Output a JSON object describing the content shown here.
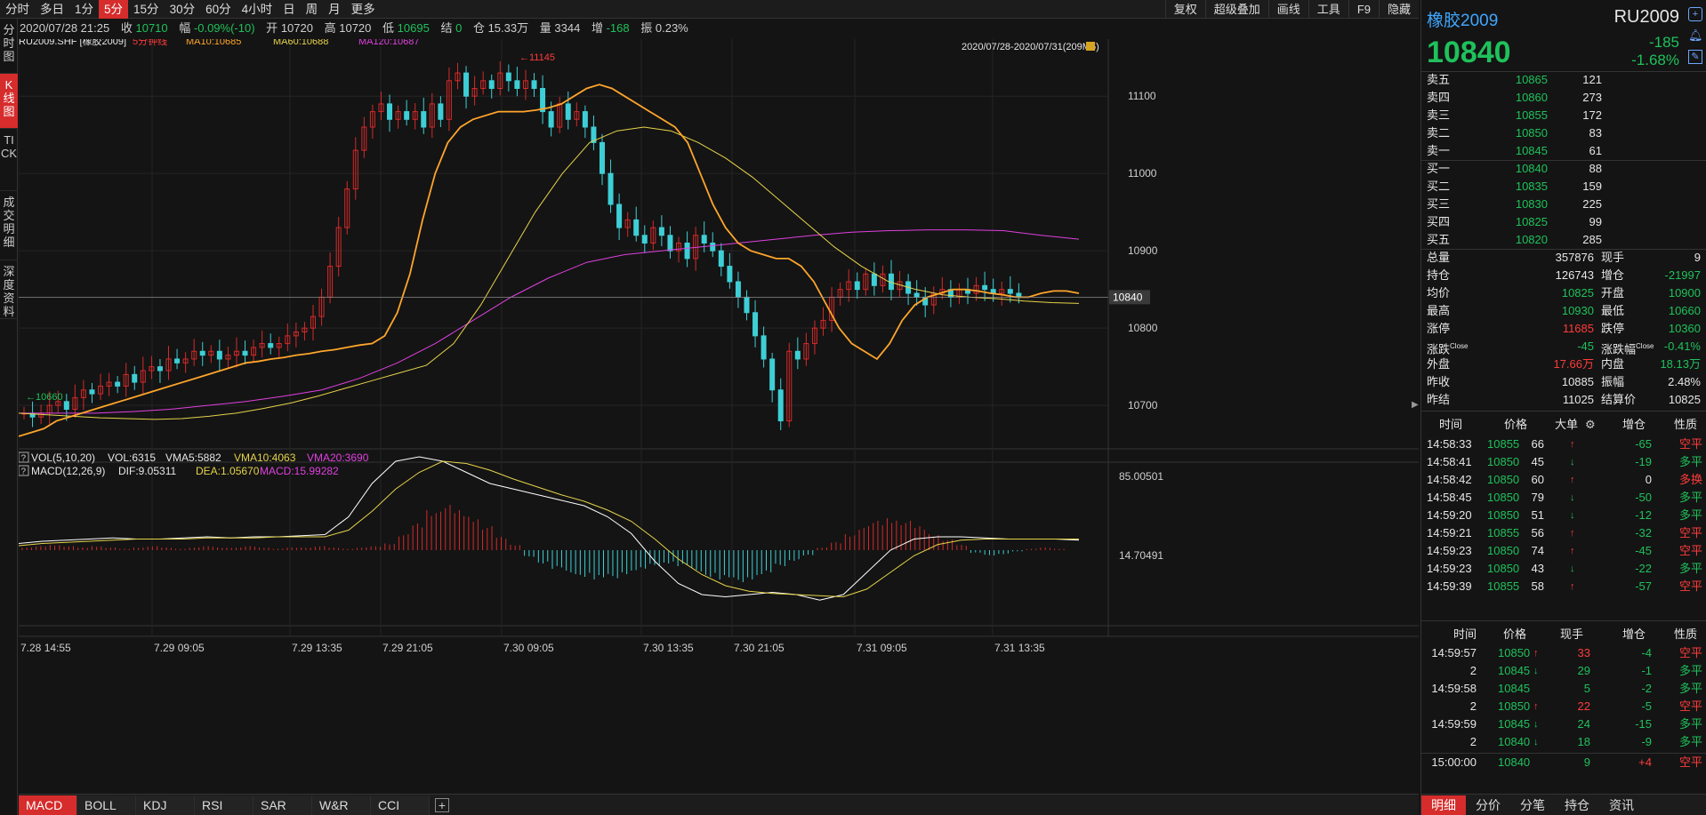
{
  "colors": {
    "up": "#ff3b3b",
    "down": "#1fc15b",
    "ma10": "#ffa52b",
    "ma60": "#e6d34a",
    "ma120": "#e040e0",
    "candle_up": "#d42a2a",
    "candle_down": "#3ecfd6",
    "active_tab": "#d62c2c"
  },
  "period_tabs": [
    "分时",
    "多日",
    "1分",
    "5分",
    "15分",
    "30分",
    "60分",
    "4小时",
    "日",
    "周",
    "月",
    "更多"
  ],
  "active_period": "5分",
  "right_buttons": [
    "复权",
    "超级叠加",
    "画线",
    "工具",
    "F9",
    "隐藏"
  ],
  "side_tabs": [
    "分时图",
    "K线图",
    "TICK",
    "成交明细",
    "深度资料"
  ],
  "active_side_tab": "K线图",
  "quote_bar": {
    "datetime": "2020/07/28 21:25",
    "close_label": "收",
    "close": "10710",
    "change_label": "幅",
    "change": "-0.09%(-10)",
    "open_label": "开",
    "open": "10720",
    "high_label": "高",
    "high": "10720",
    "low_label": "低",
    "low": "10695",
    "settle_label": "结",
    "settle": "0",
    "oi_label": "仓",
    "oi": "15.33万",
    "vol_label": "量",
    "vol": "3344",
    "inc_label": "增",
    "inc": "-168",
    "amp_label": "振",
    "amp": "0.23%"
  },
  "chart_header": {
    "symbol": "RU2009.SHF [橡胶2009]",
    "period": "5分钟线",
    "ma10": "MA10:10685",
    "ma60": "MA60:10688",
    "ma120": "MA120:10687",
    "range": "2020/07/28-2020/07/31(209M5)"
  },
  "vol_header": {
    "q": "?",
    "name": "VOL(5,10,20)",
    "vol": "VOL:6315",
    "vma5": "VMA5:5882",
    "vma10": "VMA10:4063",
    "vma20": "VMA20:3690"
  },
  "macd_header": {
    "q": "?",
    "name": "MACD(12,26,9)",
    "dif": "DIF:9.05311",
    "dea": "DEA:1.05670",
    "macd": "MACD:15.99282"
  },
  "indicator_tabs": [
    "MACD",
    "BOLL",
    "KDJ",
    "RSI",
    "SAR",
    "W&R",
    "CCI"
  ],
  "active_indicator": "MACD",
  "add_indicator": "+",
  "chart_data": {
    "type": "candlestick",
    "price_axis_ticks": [
      11100,
      11000,
      10900,
      10800,
      10700
    ],
    "ylim": [
      10640,
      11150
    ],
    "current_price": 10840,
    "current_price_label": "10840",
    "max_marker": "11145",
    "min_marker": "10660",
    "time_ticks": [
      "7.28 14:55",
      "7.29 09:05",
      "7.29 13:35",
      "7.29 21:05",
      "7.30 09:05",
      "7.30 13:35",
      "7.30 21:05",
      "7.31 09:05",
      "7.31 13:35"
    ],
    "macd_axis_ticks": [
      "85.00501",
      "14.70491"
    ],
    "close_path": [
      10690,
      10685,
      10690,
      10700,
      10705,
      10695,
      10710,
      10720,
      10715,
      10725,
      10730,
      10725,
      10740,
      10730,
      10745,
      10750,
      10745,
      10760,
      10755,
      10760,
      10770,
      10765,
      10770,
      10760,
      10765,
      10770,
      10765,
      10775,
      10780,
      10775,
      10780,
      10790,
      10795,
      10800,
      10815,
      10840,
      10880,
      10930,
      10980,
      11030,
      11060,
      11080,
      11090,
      11070,
      11080,
      11070,
      11080,
      11060,
      11090,
      11070,
      11120,
      11130,
      11100,
      11110,
      11120,
      11110,
      11130,
      11120,
      11110,
      11120,
      11110,
      11080,
      11060,
      11090,
      11070,
      11080,
      11060,
      11040,
      11000,
      10960,
      10930,
      10940,
      10920,
      10910,
      10930,
      10920,
      10900,
      10910,
      10890,
      10920,
      10910,
      10900,
      10880,
      10860,
      10840,
      10820,
      10790,
      10760,
      10720,
      10680,
      10770,
      10760,
      10780,
      10800,
      10810,
      10840,
      10850,
      10860,
      10850,
      10870,
      10855,
      10870,
      10850,
      10860,
      10845,
      10840,
      10830,
      10845,
      10850,
      10840,
      10850,
      10845,
      10855,
      10850,
      10845,
      10850,
      10845,
      10840
    ],
    "ma10_path": [
      10660,
      10665,
      10670,
      10680,
      10685,
      10690,
      10695,
      10700,
      10705,
      10710,
      10715,
      10720,
      10725,
      10730,
      10735,
      10740,
      10745,
      10750,
      10755,
      10757,
      10760,
      10762,
      10765,
      10767,
      10770,
      10772,
      10775,
      10778,
      10780,
      10790,
      10820,
      10870,
      10940,
      11000,
      11040,
      11060,
      11070,
      11075,
      11080,
      11080,
      11080,
      11082,
      11085,
      11090,
      11100,
      11110,
      11115,
      11110,
      11100,
      11090,
      11080,
      11070,
      11060,
      11040,
      11000,
      10960,
      10930,
      10910,
      10900,
      10895,
      10890,
      10890,
      10880,
      10860,
      10830,
      10800,
      10780,
      10770,
      10760,
      10780,
      10810,
      10830,
      10840,
      10845,
      10850,
      10850,
      10848,
      10845,
      10843,
      10840,
      10840,
      10845,
      10848,
      10848,
      10845
    ],
    "ma60_path": [
      10690,
      10688,
      10686,
      10684,
      10683,
      10682,
      10683,
      10686,
      10690,
      10696,
      10703,
      10712,
      10722,
      10732,
      10742,
      10752,
      10780,
      10830,
      10890,
      10950,
      11000,
      11040,
      11055,
      11060,
      11055,
      11040,
      11020,
      10995,
      10965,
      10935,
      10905,
      10880,
      10860,
      10850,
      10843,
      10840,
      10838,
      10835,
      10833,
      10832
    ],
    "ma120_path": [
      10690,
      10690,
      10690,
      10692,
      10695,
      10700,
      10705,
      10712,
      10720,
      10735,
      10755,
      10780,
      10810,
      10840,
      10865,
      10885,
      10895,
      10900,
      10905,
      10910,
      10915,
      10920,
      10924,
      10926,
      10927,
      10927,
      10926,
      10920,
      10915
    ],
    "volume_bars": [],
    "macd_hist": [
      2,
      3,
      4,
      3,
      2,
      3,
      2,
      1,
      2,
      3,
      2,
      1,
      2,
      3,
      2,
      2,
      3,
      2,
      1,
      2,
      2,
      3,
      2,
      1,
      2,
      3,
      5,
      12,
      20,
      30,
      34,
      30,
      25,
      18,
      10,
      4,
      -5,
      -10,
      -14,
      -18,
      -20,
      -22,
      -21,
      -18,
      -15,
      -12,
      -10,
      -12,
      -16,
      -20,
      -22,
      -24,
      -22,
      -18,
      -12,
      -8,
      -4,
      2,
      6,
      12,
      18,
      22,
      24,
      22,
      18,
      12,
      8,
      4,
      -2,
      -4,
      -3,
      -1,
      1,
      2,
      1,
      0
    ],
    "dif_path": [
      6,
      8,
      9,
      10,
      11,
      10,
      10,
      11,
      12,
      11,
      12,
      12,
      13,
      14,
      30,
      60,
      80,
      84,
      80,
      70,
      60,
      55,
      50,
      45,
      40,
      30,
      15,
      -10,
      -30,
      -40,
      -42,
      -40,
      -38,
      -40,
      -45,
      -40,
      -20,
      0,
      10,
      12,
      12,
      11,
      10,
      10,
      10,
      9
    ],
    "dea_path": [
      4,
      6,
      7,
      8,
      9,
      10,
      10,
      10,
      11,
      11,
      11,
      12,
      12,
      12,
      18,
      35,
      55,
      70,
      80,
      78,
      72,
      64,
      57,
      50,
      44,
      36,
      26,
      10,
      -8,
      -22,
      -32,
      -37,
      -39,
      -40,
      -41,
      -42,
      -35,
      -20,
      -5,
      5,
      9,
      10,
      10,
      10,
      10,
      10
    ]
  },
  "right_panel": {
    "name": "橡胶2009",
    "code": "RU2009",
    "price": "10840",
    "change": "-185",
    "change_pct": "-1.68%",
    "asks": [
      {
        "label": "卖五",
        "price": "10865",
        "vol": "121"
      },
      {
        "label": "卖四",
        "price": "10860",
        "vol": "273"
      },
      {
        "label": "卖三",
        "price": "10855",
        "vol": "172"
      },
      {
        "label": "卖二",
        "price": "10850",
        "vol": "83"
      },
      {
        "label": "卖一",
        "price": "10845",
        "vol": "61"
      }
    ],
    "bids": [
      {
        "label": "买一",
        "price": "10840",
        "vol": "88"
      },
      {
        "label": "买二",
        "price": "10835",
        "vol": "159"
      },
      {
        "label": "买三",
        "price": "10830",
        "vol": "225"
      },
      {
        "label": "买四",
        "price": "10825",
        "vol": "99"
      },
      {
        "label": "买五",
        "price": "10820",
        "vol": "285"
      }
    ],
    "stats": [
      [
        {
          "k": "总量",
          "v": "357876",
          "c": "white"
        },
        {
          "k": "现手",
          "v": "9",
          "c": "white"
        }
      ],
      [
        {
          "k": "持仓",
          "v": "126743",
          "c": "white"
        },
        {
          "k": "增仓",
          "v": "-21997",
          "c": "green"
        }
      ],
      [
        {
          "k": "均价",
          "v": "10825",
          "c": "green"
        },
        {
          "k": "开盘",
          "v": "10900",
          "c": "green"
        }
      ],
      [
        {
          "k": "最高",
          "v": "10930",
          "c": "green"
        },
        {
          "k": "最低",
          "v": "10660",
          "c": "green"
        }
      ],
      [
        {
          "k": "涨停",
          "v": "11685",
          "c": "red"
        },
        {
          "k": "跌停",
          "v": "10360",
          "c": "green"
        }
      ],
      [
        {
          "k": "涨跌",
          "sup": "Close",
          "v": "-45",
          "c": "green"
        },
        {
          "k": "涨跌幅",
          "sup": "Close",
          "v": "-0.41%",
          "c": "green"
        }
      ],
      [
        {
          "k": "外盘",
          "v": "17.66万",
          "c": "red"
        },
        {
          "k": "内盘",
          "v": "18.13万",
          "c": "green"
        }
      ],
      [
        {
          "k": "昨收",
          "v": "10885",
          "c": "white"
        },
        {
          "k": "振幅",
          "v": "2.48%",
          "c": "white"
        }
      ],
      [
        {
          "k": "昨结",
          "v": "11025",
          "c": "white"
        },
        {
          "k": "结算价",
          "v": "10825",
          "c": "white"
        }
      ]
    ],
    "big_header": [
      "时间",
      "价格",
      "大单",
      "增仓",
      "性质"
    ],
    "big_trades": [
      {
        "t": "14:58:33",
        "p": "10855",
        "s": "66",
        "d": "up",
        "i": "-65",
        "n": "空平",
        "nc": "red"
      },
      {
        "t": "14:58:41",
        "p": "10850",
        "s": "45",
        "d": "down",
        "i": "-19",
        "n": "多平",
        "nc": "green"
      },
      {
        "t": "14:58:42",
        "p": "10850",
        "s": "60",
        "d": "up",
        "i": "0",
        "n": "多换",
        "nc": "red"
      },
      {
        "t": "14:58:45",
        "p": "10850",
        "s": "79",
        "d": "down",
        "i": "-50",
        "n": "多平",
        "nc": "green"
      },
      {
        "t": "14:59:20",
        "p": "10850",
        "s": "51",
        "d": "down",
        "i": "-12",
        "n": "多平",
        "nc": "green"
      },
      {
        "t": "14:59:21",
        "p": "10855",
        "s": "56",
        "d": "up",
        "i": "-32",
        "n": "空平",
        "nc": "red"
      },
      {
        "t": "14:59:23",
        "p": "10850",
        "s": "74",
        "d": "up",
        "i": "-45",
        "n": "空平",
        "nc": "red"
      },
      {
        "t": "14:59:23",
        "p": "10850",
        "s": "43",
        "d": "down",
        "i": "-22",
        "n": "多平",
        "nc": "green"
      },
      {
        "t": "14:59:39",
        "p": "10855",
        "s": "58",
        "d": "up",
        "i": "-57",
        "n": "空平",
        "nc": "red"
      }
    ],
    "tick_header": [
      "时间",
      "价格",
      "现手",
      "增仓",
      "性质"
    ],
    "ticks": [
      {
        "t": "14:59:57",
        "p": "10850",
        "d": "up",
        "pc": "green",
        "s": "33",
        "sc": "red",
        "i": "-4",
        "n": "空平",
        "nc": "red"
      },
      {
        "t": "2",
        "p": "10845",
        "d": "down",
        "pc": "green",
        "s": "29",
        "sc": "green",
        "i": "-1",
        "n": "多平",
        "nc": "green"
      },
      {
        "t": "14:59:58",
        "p": "10845",
        "d": "",
        "pc": "green",
        "s": "5",
        "sc": "green",
        "i": "-2",
        "n": "多平",
        "nc": "green"
      },
      {
        "t": "2",
        "p": "10850",
        "d": "up",
        "pc": "green",
        "s": "22",
        "sc": "red",
        "i": "-5",
        "n": "空平",
        "nc": "red"
      },
      {
        "t": "14:59:59",
        "p": "10845",
        "d": "down",
        "pc": "green",
        "s": "24",
        "sc": "green",
        "i": "-15",
        "n": "多平",
        "nc": "green"
      },
      {
        "t": "2",
        "p": "10840",
        "d": "down",
        "pc": "green",
        "s": "18",
        "sc": "green",
        "i": "-9",
        "n": "多平",
        "nc": "green"
      },
      {
        "t": "15:00:00",
        "p": "10840",
        "d": "",
        "pc": "green",
        "s": "9",
        "sc": "green",
        "i": "+4",
        "n": "空平",
        "nc": "red",
        "ic": "red"
      }
    ],
    "bottom_tabs": [
      "明细",
      "分价",
      "分笔",
      "持仓",
      "资讯"
    ],
    "active_bottom_tab": "明细"
  }
}
